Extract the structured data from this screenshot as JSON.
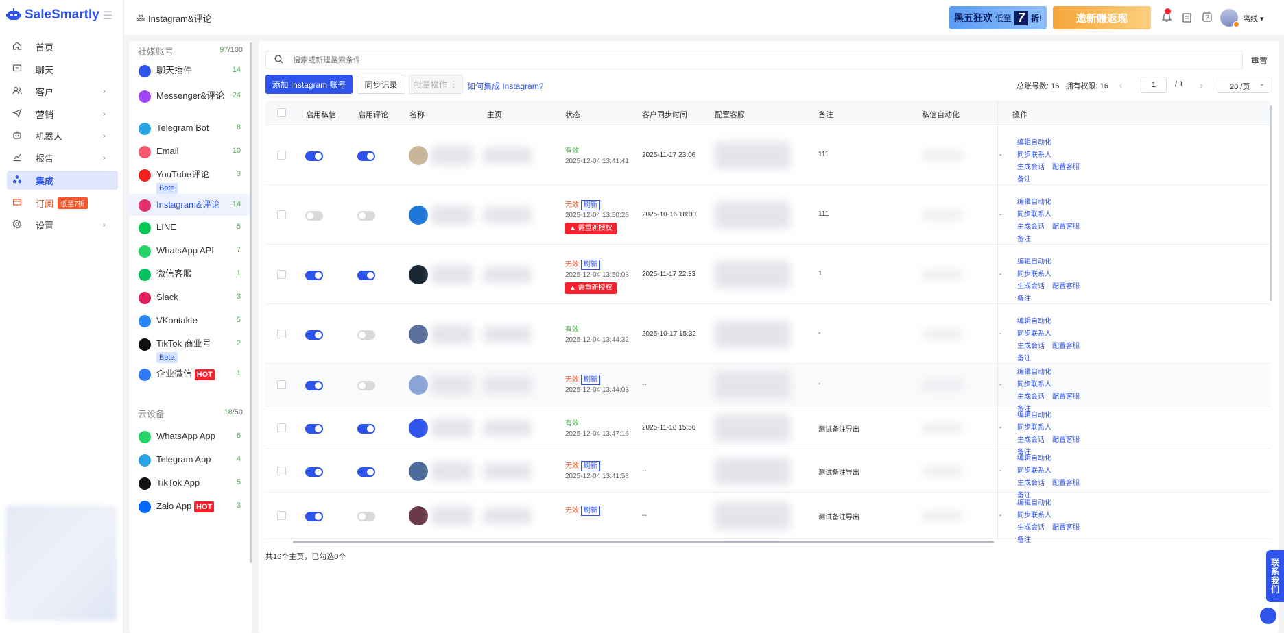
{
  "app": {
    "name": "SaleSmartly",
    "brand_color": "#2f54eb"
  },
  "nav": {
    "items": [
      {
        "label": "首页",
        "icon": "home-icon"
      },
      {
        "label": "聊天",
        "icon": "chat-icon"
      },
      {
        "label": "客户",
        "icon": "users-icon"
      },
      {
        "label": "营销",
        "icon": "send-icon"
      },
      {
        "label": "机器人",
        "icon": "robot-icon"
      },
      {
        "label": "报告",
        "icon": "chart-icon"
      },
      {
        "label": "集成",
        "icon": "integration-icon"
      },
      {
        "label": "订阅",
        "icon": "card-icon",
        "badge": "低至7折"
      },
      {
        "label": "设置",
        "icon": "gear-icon"
      }
    ]
  },
  "header": {
    "breadcrumb": "Instagram&评论",
    "banner1": {
      "text_a": "黑五狂欢",
      "text_b": "低至",
      "big": "7",
      "text_c": "折!"
    },
    "banner2": {
      "text": "邀新赚返现"
    },
    "user_status": "离线"
  },
  "panel": {
    "social_title": "社媒账号",
    "social_used": "97",
    "social_total": "/100",
    "channels": [
      {
        "name": "聊天插件",
        "count": "14",
        "color": "#2f54eb"
      },
      {
        "name": "Messenger&评论",
        "count": "24",
        "color": "#a045f5"
      },
      {
        "name": "Telegram Bot",
        "count": "8",
        "color": "#2aa3e3"
      },
      {
        "name": "Email",
        "count": "10",
        "color": "#f5576c"
      },
      {
        "name": "YouTube评论",
        "count": "3",
        "color": "#f0201e",
        "tag": "Beta"
      },
      {
        "name": "Instagram&评论",
        "count": "14",
        "color": "#e1306c"
      },
      {
        "name": "LINE",
        "count": "5",
        "color": "#06c755"
      },
      {
        "name": "WhatsApp API",
        "count": "7",
        "color": "#25d366"
      },
      {
        "name": "微信客服",
        "count": "1",
        "color": "#07c160"
      },
      {
        "name": "Slack",
        "count": "3",
        "color": "#e01e5a"
      },
      {
        "name": "VKontakte",
        "count": "5",
        "color": "#2787f5"
      },
      {
        "name": "TikTok 商业号",
        "count": "2",
        "color": "#111111",
        "tag": "Beta"
      },
      {
        "name": "企业微信",
        "count": "1",
        "color": "#2f7bf6",
        "hot": "HOT"
      }
    ],
    "cloud_title": "云设备",
    "cloud_used": "18",
    "cloud_total": "/50",
    "cloud_channels": [
      {
        "name": "WhatsApp App",
        "count": "6",
        "color": "#25d366"
      },
      {
        "name": "Telegram App",
        "count": "4",
        "color": "#2aa3e3"
      },
      {
        "name": "TikTok App",
        "count": "5",
        "color": "#111111"
      },
      {
        "name": "Zalo App",
        "count": "3",
        "color": "#0068ff",
        "hot": "HOT"
      }
    ]
  },
  "main": {
    "search_placeholder": "搜索或新建搜索条件",
    "reset": "重置",
    "btn_add": "添加 Instagram 账号",
    "btn_sync": "同步记录",
    "btn_batch": "批量操作",
    "link_how": "如何集成 Instagram?",
    "stats": "总账号数: 16   拥有权限: 16",
    "page_current": "1",
    "page_total": "/ 1",
    "page_size": "20 /页",
    "columns": [
      "启用私信",
      "启用评论",
      "名称",
      "主页",
      "状态",
      "客户同步时间",
      "配置客服",
      "备注",
      "私信自动化",
      "操作"
    ],
    "rows": [
      {
        "pm": true,
        "cm": true,
        "status": "有效",
        "valid": true,
        "time": "2025-12-04 13:41:41",
        "sync": "2025-11-17 23:06",
        "note": "111",
        "avatar": "#c9b59a"
      },
      {
        "pm": false,
        "cm": false,
        "status": "无效",
        "valid": false,
        "time": "2025-12-04 13:50:25",
        "reauth": "需重新授权",
        "sync": "2025-10-16 18:00",
        "note": "111",
        "avatar": "#1e78d6"
      },
      {
        "pm": true,
        "cm": true,
        "status": "无效",
        "valid": false,
        "time": "2025-12-04 13:50:08",
        "reauth": "需重新授权",
        "sync": "2025-11-17 22:33",
        "note": "1",
        "avatar": "#1b2634"
      },
      {
        "pm": true,
        "cm": false,
        "status": "有效",
        "valid": true,
        "time": "2025-12-04 13:44:32",
        "sync": "2025-10-17 15:32",
        "note": "-",
        "avatar": "#5a6f9c"
      },
      {
        "pm": true,
        "cm": false,
        "status": "无效",
        "valid": false,
        "time": "2025-12-04 13:44:03",
        "sync": "--",
        "note": "-",
        "avatar": "#8aa4d6"
      },
      {
        "pm": true,
        "cm": true,
        "status": "有效",
        "valid": true,
        "time": "2025-12-04 13:47:16",
        "sync": "2025-11-18 15:56",
        "note": "测试备注导出",
        "avatar": "#2f54eb"
      },
      {
        "pm": true,
        "cm": true,
        "status": "无效",
        "valid": false,
        "time": "2025-12-04 13:41:58",
        "sync": "--",
        "note": "测试备注导出",
        "avatar": "#4b6c9a"
      },
      {
        "pm": true,
        "cm": false,
        "status": "无效",
        "valid": false,
        "time": "",
        "sync": "--",
        "note": "测试备注导出",
        "avatar": "#6b3a4a"
      }
    ],
    "refresh": "刷新",
    "ops": [
      "编辑自动化",
      "同步联系人",
      "生成会话",
      "配置客服",
      "备注"
    ],
    "footer": "共16个主页，已勾选0个"
  },
  "contact": "联系我们"
}
